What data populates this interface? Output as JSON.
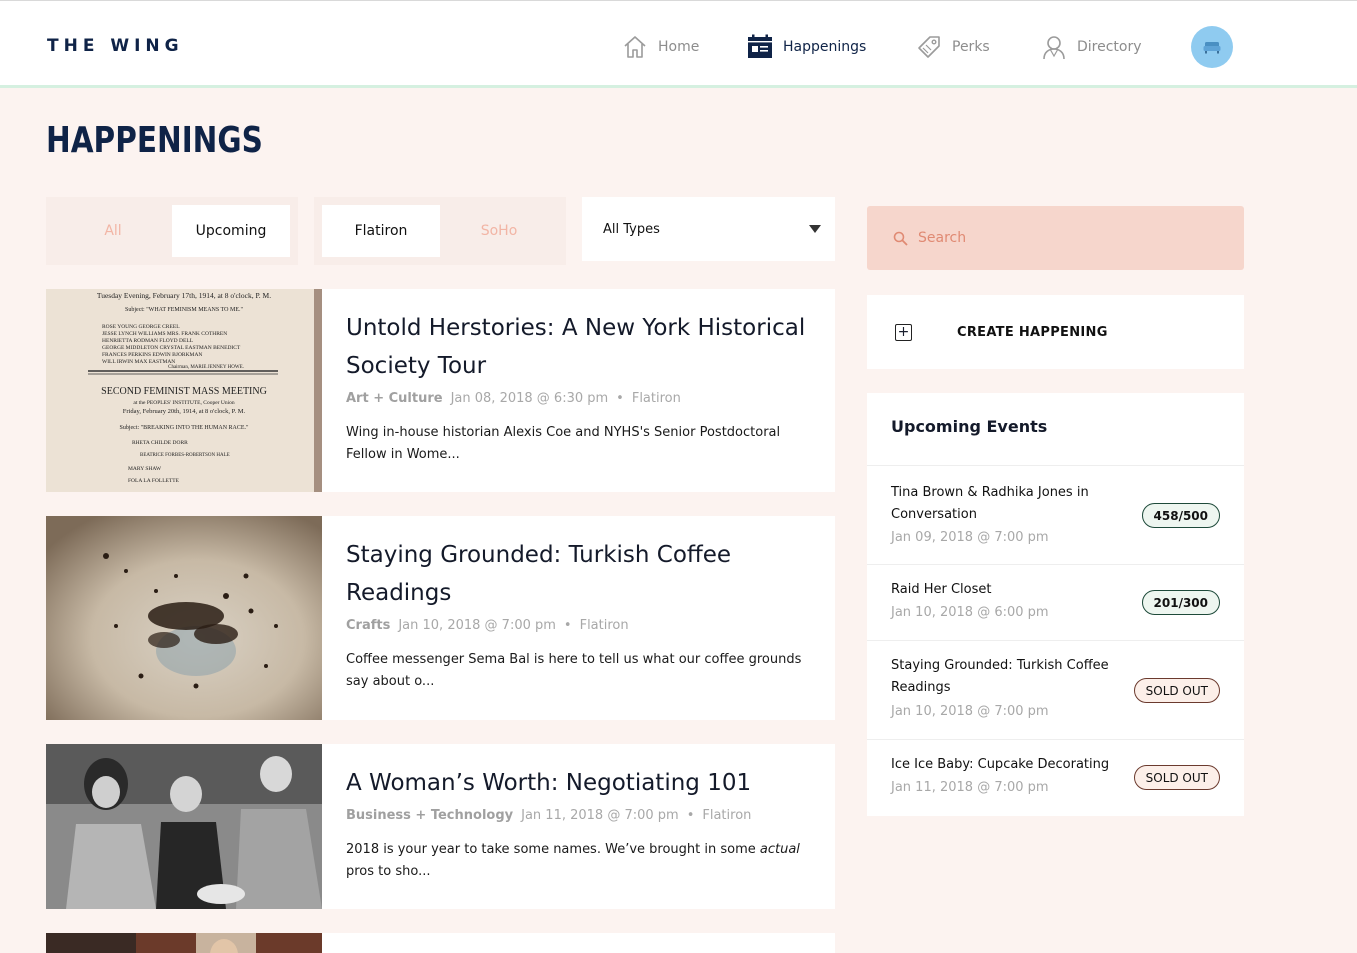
{
  "brand": {
    "logo": "THE WING"
  },
  "nav": {
    "items": [
      {
        "label": "Home",
        "icon": "home-icon"
      },
      {
        "label": "Happenings",
        "icon": "calendar-icon",
        "active": true
      },
      {
        "label": "Perks",
        "icon": "tag-icon"
      },
      {
        "label": "Directory",
        "icon": "person-icon"
      }
    ]
  },
  "page": {
    "title": "HAPPENINGS"
  },
  "filters": {
    "time": [
      {
        "label": "All"
      },
      {
        "label": "Upcoming",
        "selected": true
      }
    ],
    "location": [
      {
        "label": "Flatiron",
        "selected": true
      },
      {
        "label": "SoHo"
      }
    ],
    "type_select": {
      "value": "All Types"
    }
  },
  "events": [
    {
      "title": "Untold Herstories: A New York Historical Society Tour",
      "category": "Art + Culture",
      "date": "Jan 08, 2018 @ 6:30 pm",
      "location": "Flatiron",
      "description": "Wing in-house historian Alexis Coe and NYHS's Senior Postdoctoral Fellow in Wome..."
    },
    {
      "title": "Staying Grounded: Turkish Coffee Readings",
      "category": "Crafts",
      "date": "Jan 10, 2018 @ 7:00 pm",
      "location": "Flatiron",
      "description": "Coffee messenger Sema Bal is here to tell us what our coffee grounds say about o..."
    },
    {
      "title": "A Woman’s Worth: Negotiating 101",
      "category": "Business + Technology",
      "date": "Jan 11, 2018 @ 7:00 pm",
      "location": "Flatiron",
      "description_pre": "2018 is your year to take some names. We’ve brought in some ",
      "description_em": "actual",
      "description_post": " pros to sho..."
    }
  ],
  "thumb_poster": {
    "lines": [
      "Tuesday Evening, February 17th, 1914, at 8 o'clock, P. M.",
      "Subject: \"WHAT FEMINISM MEANS TO ME.\"",
      "ROSE YOUNG   GEORGE CREEL",
      "JESSE LYNCH WILLIAMS   MRS. FRANK COTHREN",
      "HENRIETTA RODMAN   FLOYD DELL",
      "GEORGE MIDDLETON   CRYSTAL EASTMAN BENEDICT",
      "FRANCES PERKINS   EDWIN BJORKMAN",
      "WILL IRWIN   MAX EASTMAN",
      "Chairman, MARIE JENNEY HOWE.",
      "SECOND FEMINIST MASS MEETING",
      "at the PEOPLES' INSTITUTE, Cooper Union",
      "Friday, February 20th, 1914, at 8 o'clock, P. M.",
      "Subject: \"BREAKING INTO THE HUMAN RACE.\"",
      "RHETA CHILDE DORR",
      "BEATRICE FORBES-ROBERTSON HALE",
      "MARY SHAW",
      "FOLA LA FOLLETTE"
    ]
  },
  "sidebar": {
    "search_placeholder": "Search",
    "create_label": "CREATE HAPPENING",
    "upcoming": {
      "title": "Upcoming Events",
      "items": [
        {
          "name": "Tina Brown & Radhika Jones in Conversation",
          "date": "Jan 09, 2018 @ 7:00 pm",
          "badge": "458/500",
          "sold_out": false
        },
        {
          "name": "Raid Her Closet",
          "date": "Jan 10, 2018 @ 6:00 pm",
          "badge": "201/300",
          "sold_out": false
        },
        {
          "name": "Staying Grounded: Turkish Coffee Readings",
          "date": "Jan 10, 2018 @ 7:00 pm",
          "badge": "SOLD OUT",
          "sold_out": true
        },
        {
          "name": "Ice Ice Baby: Cupcake Decorating",
          "date": "Jan 11, 2018 @ 7:00 pm",
          "badge": "SOLD OUT",
          "sold_out": true
        }
      ]
    }
  },
  "colors": {
    "navy": "#0f2347",
    "page_bg": "#fcf3f0",
    "search_bg": "#f6d6cc",
    "accent_pink": "#f2b5a5"
  }
}
